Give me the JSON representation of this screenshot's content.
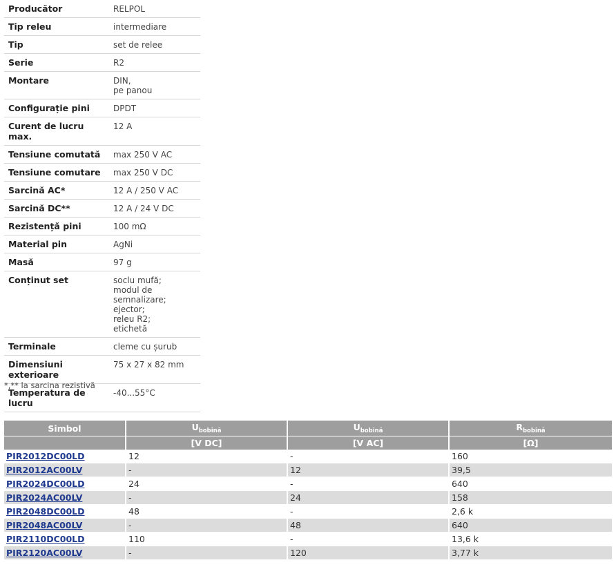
{
  "specs": [
    {
      "key": "Producător",
      "value": "RELPOL"
    },
    {
      "key": "Tip releu",
      "value": "intermediare"
    },
    {
      "key": "Tip",
      "value": "set de relee"
    },
    {
      "key": "Serie",
      "value": "R2"
    },
    {
      "key": "Montare",
      "value": "DIN,\npe panou"
    },
    {
      "key": "Configurație pini",
      "value": "DPDT"
    },
    {
      "key": "Curent de lucru max.",
      "value": "12 A"
    },
    {
      "key": "Tensiune comutată",
      "value": "max 250 V AC"
    },
    {
      "key": "Tensiune comutare",
      "value": "max 250 V DC"
    },
    {
      "key": "Sarcină AC*",
      "value": "12 A / 250 V AC"
    },
    {
      "key": "Sarcină DC**",
      "value": "12 A / 24 V DC"
    },
    {
      "key": "Rezistență pini",
      "value": "100 mΩ"
    },
    {
      "key": "Material pin",
      "value": "AgNi"
    },
    {
      "key": "Masă",
      "value": "97 g"
    },
    {
      "key": "Conținut set",
      "value": "soclu mufă;\nmodul de semnalizare;\nejector;\nreleu R2;\netichetă"
    },
    {
      "key": "Terminale",
      "value": "cleme cu șurub"
    },
    {
      "key": "Dimensiuni exterioare",
      "value": "75 x 27 x 82 mm"
    },
    {
      "key": "Temperatura de lucru",
      "value": "-40...55°C"
    }
  ],
  "note": "*,** la sarcina rezistivă",
  "products": {
    "headers": {
      "simbol": "Simbol",
      "u_main": "U",
      "u_sub": "bobină",
      "r_main": "R",
      "r_sub": "bobină",
      "unit_vdc": "[V DC]",
      "unit_vac": "[V AC]",
      "unit_ohm": "[Ω]"
    },
    "rows": [
      {
        "simbol": "PIR2012DC00LD",
        "vdc": "12",
        "vac": "-",
        "r": "160"
      },
      {
        "simbol": "PIR2012AC00LV",
        "vdc": "-",
        "vac": "12",
        "r": "39,5"
      },
      {
        "simbol": "PIR2024DC00LD",
        "vdc": "24",
        "vac": "-",
        "r": "640"
      },
      {
        "simbol": "PIR2024AC00LV",
        "vdc": "-",
        "vac": "24",
        "r": "158"
      },
      {
        "simbol": "PIR2048DC00LD",
        "vdc": "48",
        "vac": "-",
        "r": "2,6 k"
      },
      {
        "simbol": "PIR2048AC00LV",
        "vdc": "-",
        "vac": "48",
        "r": "640"
      },
      {
        "simbol": "PIR2110DC00LD",
        "vdc": "110",
        "vac": "-",
        "r": "13,6 k"
      },
      {
        "simbol": "PIR2120AC00LV",
        "vdc": "-",
        "vac": "120",
        "r": "3,77 k"
      }
    ]
  }
}
